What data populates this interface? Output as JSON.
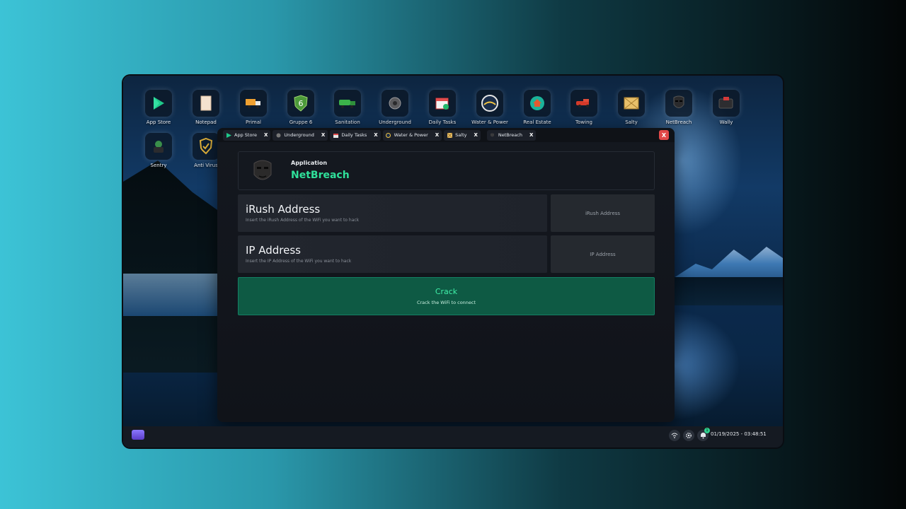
{
  "desktop": {
    "icons": [
      {
        "label": "App Store",
        "icon": "play-store-icon"
      },
      {
        "label": "Notepad",
        "icon": "notepad-icon"
      },
      {
        "label": "Primal",
        "icon": "truck-icon"
      },
      {
        "label": "Gruppe 6",
        "icon": "shield-six-icon"
      },
      {
        "label": "Sanitation",
        "icon": "garbage-truck-icon"
      },
      {
        "label": "Underground",
        "icon": "underground-icon"
      },
      {
        "label": "Daily Tasks",
        "icon": "calendar-check-icon"
      },
      {
        "label": "Water & Power",
        "icon": "water-power-icon"
      },
      {
        "label": "Real Estate",
        "icon": "house-icon"
      },
      {
        "label": "Towing",
        "icon": "tow-truck-icon"
      },
      {
        "label": "Salty",
        "icon": "crate-icon"
      },
      {
        "label": "NetBreach",
        "icon": "mask-icon"
      },
      {
        "label": "Wally",
        "icon": "wallet-icon"
      },
      {
        "label": "Sentry",
        "icon": "sentry-icon"
      },
      {
        "label": "Anti Virus",
        "icon": "shield-check-icon"
      }
    ]
  },
  "window": {
    "tabs": [
      {
        "label": "App Store",
        "close": "X"
      },
      {
        "label": "Underground",
        "close": "X"
      },
      {
        "label": "Daily Tasks",
        "close": "X"
      },
      {
        "label": "Water & Power",
        "close": "X"
      },
      {
        "label": "Salty",
        "close": "X"
      },
      {
        "label": "NetBreach",
        "close": "X"
      }
    ],
    "close_label": "X",
    "app": {
      "kicker": "Application",
      "title": "NetBreach"
    },
    "fields": [
      {
        "title": "iRush Address",
        "description": "Insert the iRush Address of the WiFi you want to hack",
        "placeholder": "iRush Address"
      },
      {
        "title": "IP Address",
        "description": "Insert the IP Address of the WiFi you want to hack",
        "placeholder": "IP Address"
      }
    ],
    "action": {
      "label": "Crack",
      "sublabel": "Crack the WiFi to connect"
    }
  },
  "taskbar": {
    "notification_count": "1",
    "datetime": "01/19/2025 - 03:48:51"
  },
  "colors": {
    "accent": "#2fe09a",
    "crack_bg": "#0e5a44",
    "close_red": "#e04848"
  }
}
